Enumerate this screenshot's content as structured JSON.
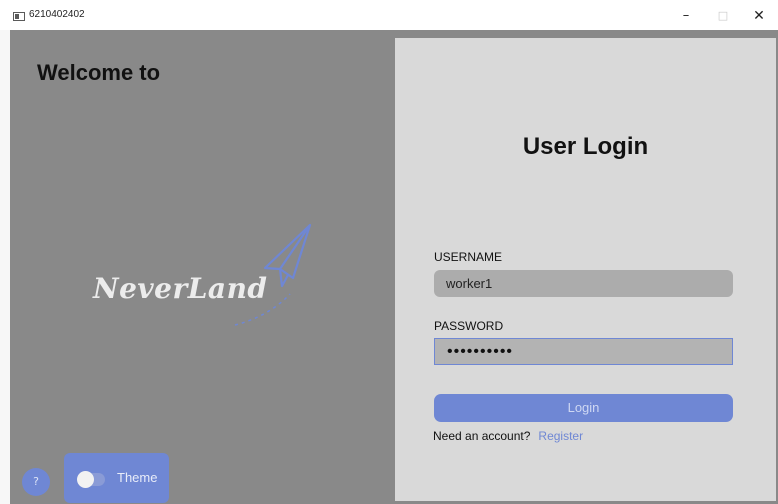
{
  "window": {
    "title": "6210402402",
    "minimize": "–",
    "maximize": "□",
    "close": "✕"
  },
  "left": {
    "welcome": "Welcome to",
    "logo_text": "NeverLand",
    "help_label": "?",
    "theme_label": "Theme",
    "theme_enabled": false
  },
  "login": {
    "title": "User Login",
    "username_label": "USERNAME",
    "username_value": "worker1",
    "password_label": "PASSWORD",
    "password_value": "••••••••••",
    "login_button": "Login",
    "account_prompt": "Need an account?",
    "register_link": "Register"
  },
  "colors": {
    "accent": "#6f87d4",
    "overlay": "#898989",
    "panel": "#d9d9d9"
  }
}
